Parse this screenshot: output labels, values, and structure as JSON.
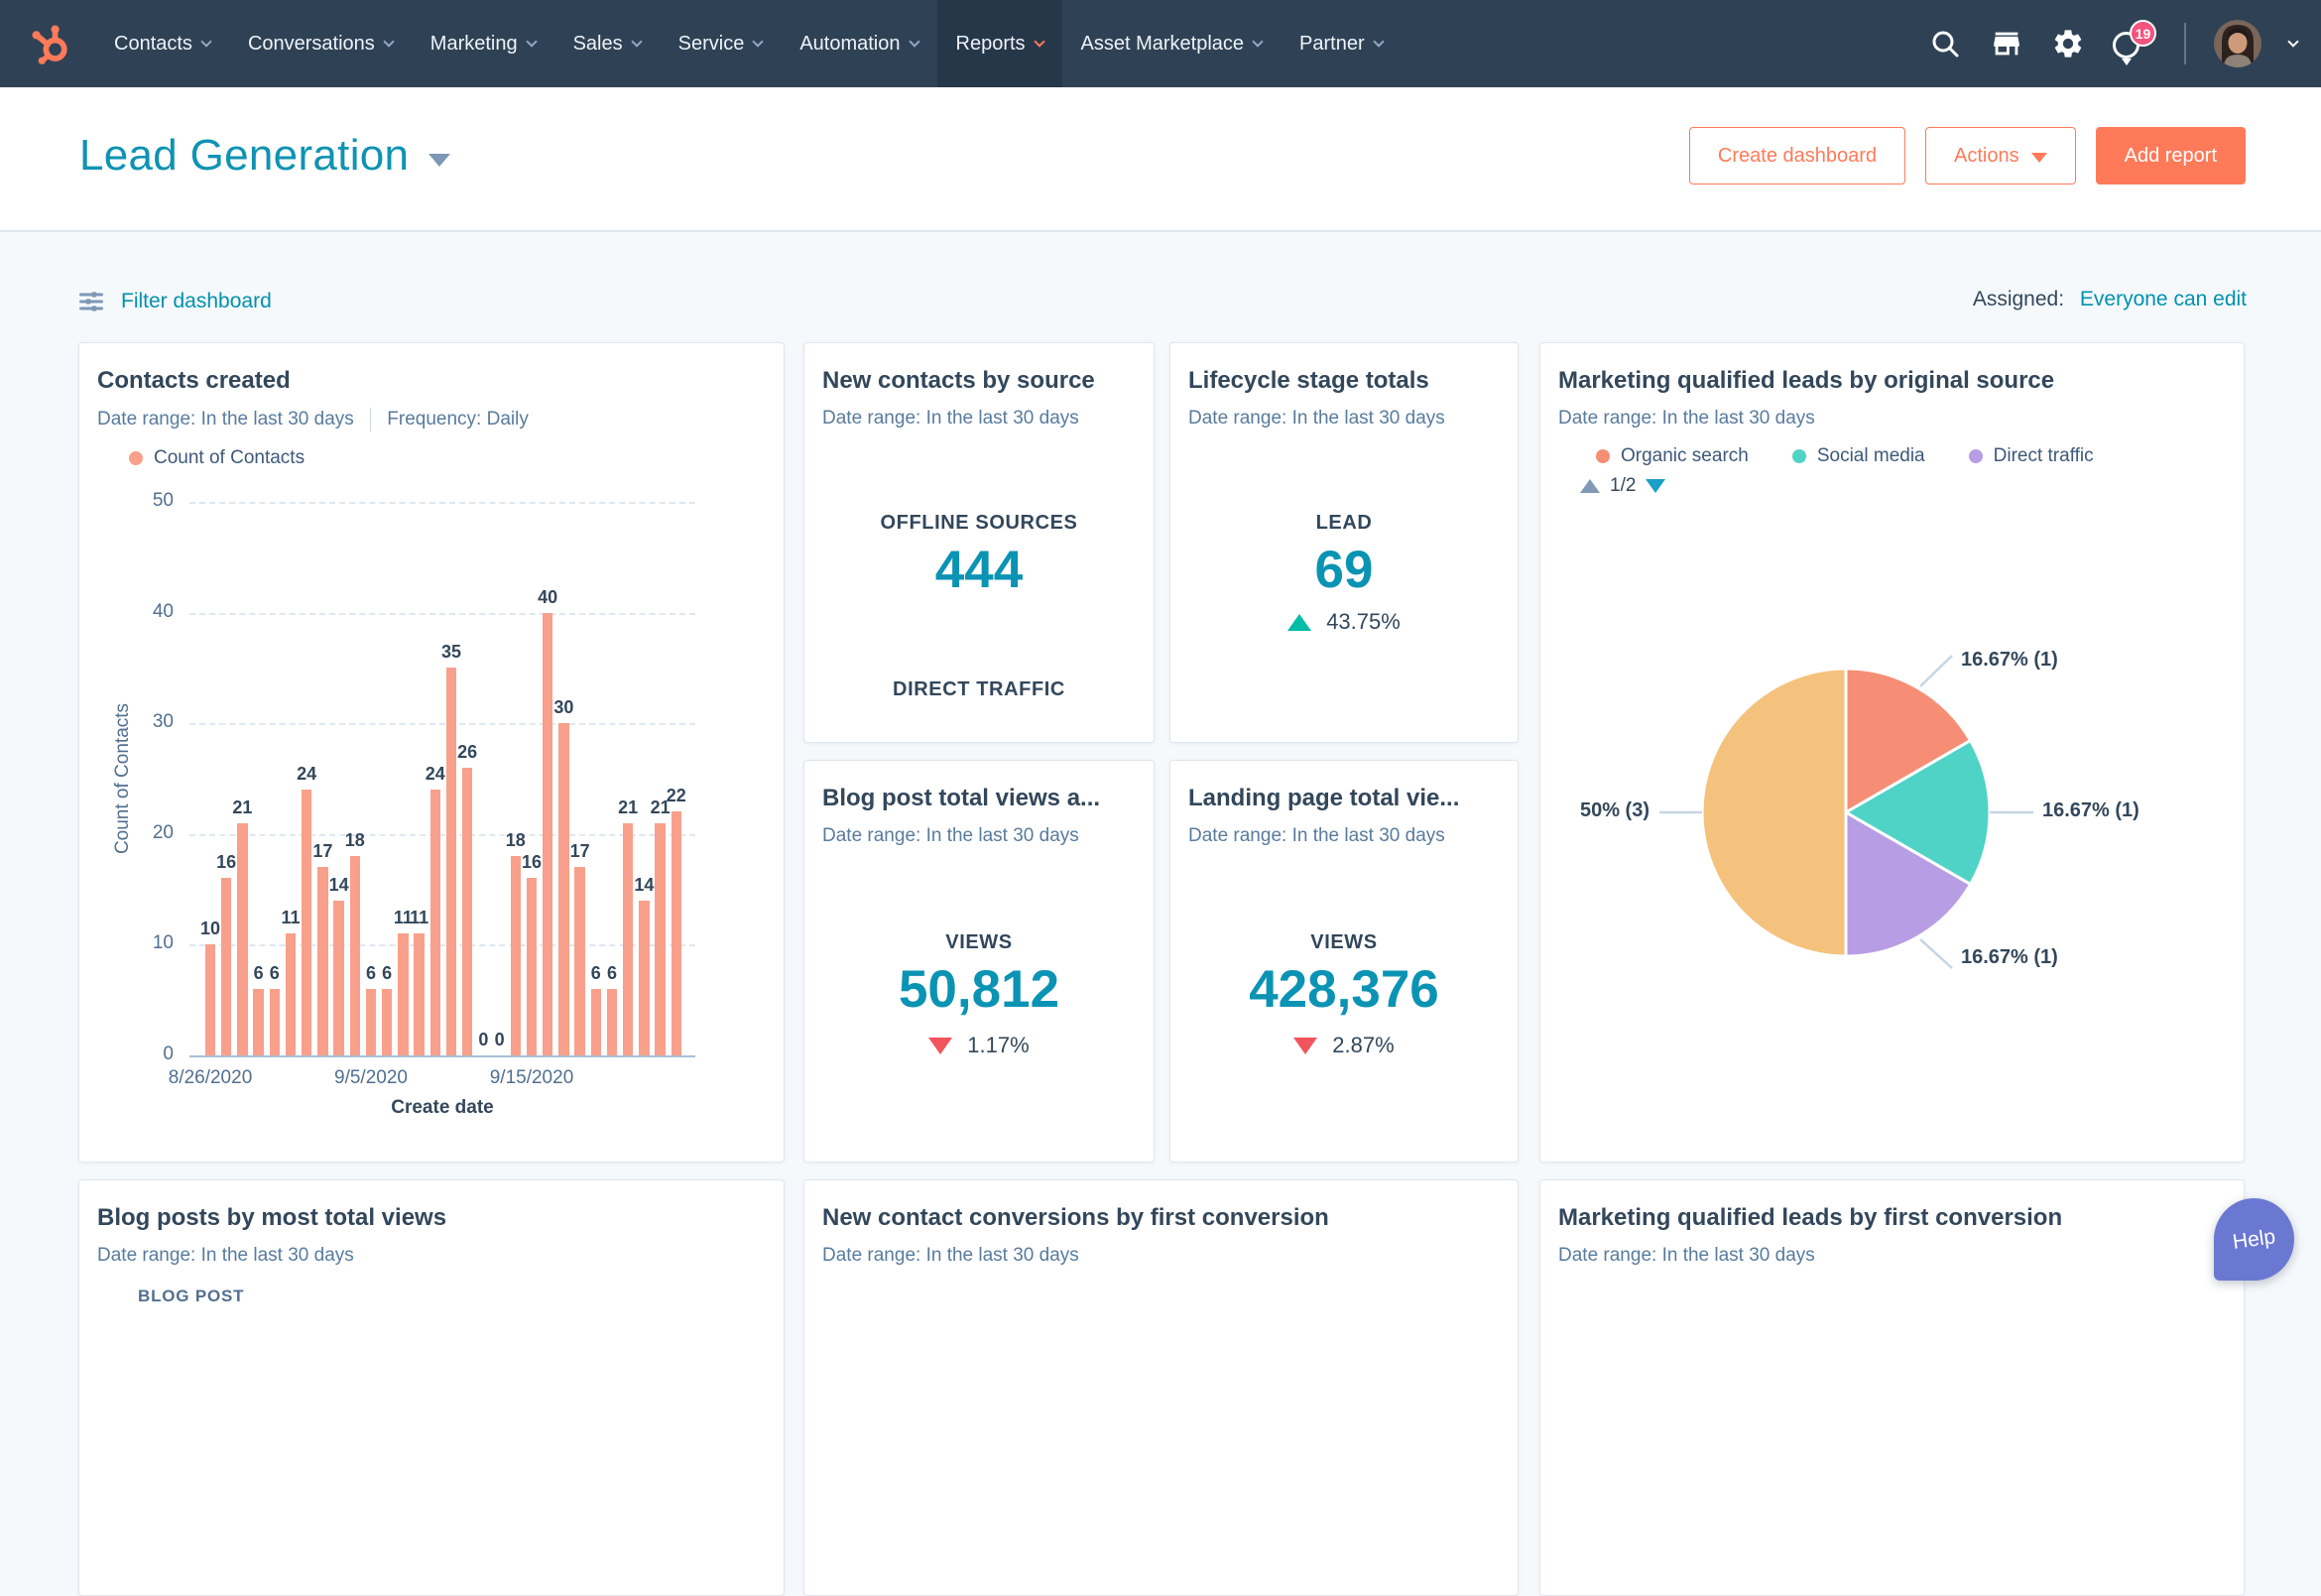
{
  "colors": {
    "nav_bg": "#2f4255",
    "accent_orange": "#ff7a59",
    "teal": "#0091ae",
    "positive_green": "#00bda5",
    "negative_red": "#f2545b",
    "badge_pink": "#f2547d",
    "bar_salmon": "#f8a08b",
    "help_purple": "#6a78d1"
  },
  "nav": {
    "items": [
      {
        "label": "Contacts"
      },
      {
        "label": "Conversations"
      },
      {
        "label": "Marketing"
      },
      {
        "label": "Sales"
      },
      {
        "label": "Service"
      },
      {
        "label": "Automation"
      },
      {
        "label": "Reports"
      },
      {
        "label": "Asset Marketplace"
      },
      {
        "label": "Partner"
      }
    ],
    "active_item": "Reports",
    "notification_count": "19"
  },
  "header": {
    "title": "Lead Generation",
    "create_dashboard_label": "Create dashboard",
    "actions_label": "Actions",
    "add_report_label": "Add report"
  },
  "toolbar": {
    "filter_label": "Filter dashboard",
    "assigned_label": "Assigned:",
    "assigned_value": "Everyone can edit"
  },
  "cards": {
    "contacts_created": {
      "title": "Contacts created",
      "date_range": "Date range: In the last 30 days",
      "frequency": "Frequency: Daily",
      "legend": "Count of Contacts"
    },
    "new_contacts_by_source": {
      "title": "New contacts by source",
      "date_range": "Date range: In the last 30 days",
      "primary_label": "OFFLINE SOURCES",
      "primary_value": "444",
      "secondary_label": "DIRECT TRAFFIC"
    },
    "lifecycle_stage_totals": {
      "title": "Lifecycle stage totals",
      "date_range": "Date range: In the last 30 days",
      "primary_label": "LEAD",
      "primary_value": "69",
      "delta": "43.75%",
      "delta_direction": "up"
    },
    "mql_by_original_source": {
      "title": "Marketing qualified leads by original source",
      "date_range": "Date range: In the last 30 days",
      "legend_page": "1/2"
    },
    "blog_post_views": {
      "title": "Blog post total views a...",
      "date_range": "Date range: In the last 30 days",
      "primary_label": "VIEWS",
      "primary_value": "50,812",
      "delta": "1.17%",
      "delta_direction": "down"
    },
    "landing_page_views": {
      "title": "Landing page total vie...",
      "date_range": "Date range: In the last 30 days",
      "primary_label": "VIEWS",
      "primary_value": "428,376",
      "delta": "2.87%",
      "delta_direction": "down"
    },
    "blog_posts_by_views": {
      "title": "Blog posts by most total views",
      "date_range": "Date range: In the last 30 days",
      "column_header": "BLOG POST"
    },
    "contact_conversions": {
      "title": "New contact conversions by first conversion",
      "date_range": "Date range: In the last 30 days"
    },
    "mql_by_first_conversion": {
      "title": "Marketing qualified leads by first conversion",
      "date_range": "Date range: In the last 30 days"
    }
  },
  "chart_data": [
    {
      "type": "bar",
      "title": "Contacts created",
      "series": [
        {
          "name": "Count of Contacts",
          "color": "#f8a08b",
          "values": [
            10,
            16,
            21,
            6,
            6,
            11,
            24,
            17,
            14,
            18,
            6,
            6,
            11,
            11,
            24,
            35,
            26,
            0,
            0,
            18,
            16,
            40,
            30,
            17,
            6,
            6,
            21,
            14,
            21,
            22
          ]
        }
      ],
      "x_tick_labels": [
        {
          "index": 0,
          "label": "8/26/2020"
        },
        {
          "index": 10,
          "label": "9/5/2020"
        },
        {
          "index": 20,
          "label": "9/15/2020"
        }
      ],
      "xlabel": "Create date",
      "ylabel": "Count of Contacts",
      "ylim": [
        0,
        50
      ],
      "y_ticks": [
        0,
        10,
        20,
        30,
        40,
        50
      ],
      "grid": "horizontal-dashed"
    },
    {
      "type": "pie",
      "title": "Marketing qualified leads by original source",
      "start": "top",
      "direction": "clockwise",
      "slices": [
        {
          "label": "16.67% (1)",
          "value": 1,
          "color": "#f58e74",
          "legend": "Organic search"
        },
        {
          "label": "16.67% (1)",
          "value": 1,
          "color": "#4fd3c6",
          "legend": "Social media"
        },
        {
          "label": "16.67% (1)",
          "value": 1,
          "color": "#b79de4",
          "legend": "Direct traffic"
        },
        {
          "label": "50% (3)",
          "value": 3,
          "color": "#f4c27c"
        }
      ],
      "legend_position": "top",
      "legend_page": "1/2"
    }
  ],
  "help": {
    "label": "Help"
  }
}
